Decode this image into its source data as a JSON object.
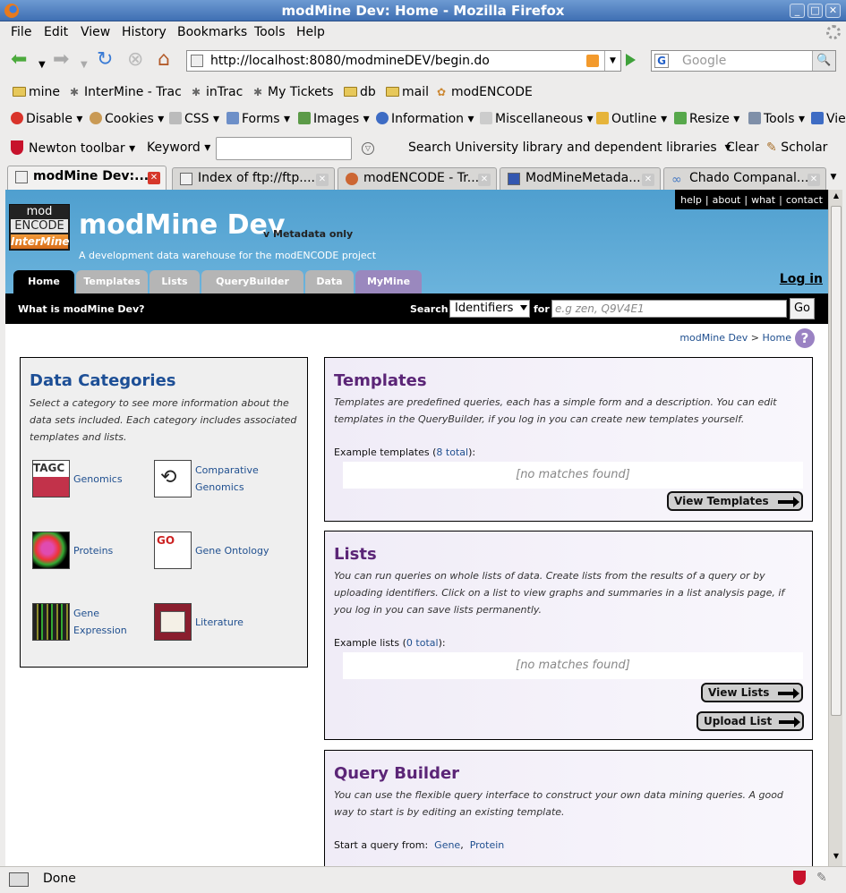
{
  "window": {
    "title": "modMine Dev: Home - Mozilla Firefox"
  },
  "menu": [
    "File",
    "Edit",
    "View",
    "History",
    "Bookmarks",
    "Tools",
    "Help"
  ],
  "nav": {
    "url": "http://localhost:8080/modmineDEV/begin.do",
    "search_placeholder": "Google"
  },
  "bookmarks": [
    "mine",
    "InterMine - Trac",
    "inTrac",
    "My Tickets",
    "db",
    "mail",
    "modENCODE"
  ],
  "webdev": [
    "Disable",
    "Cookies",
    "CSS",
    "Forms",
    "Images",
    "Information",
    "Miscellaneous",
    "Outline",
    "Resize",
    "Tools",
    "Vie"
  ],
  "newton": {
    "toolbar": "Newton toolbar",
    "keyword": "Keyword",
    "search_lib": "Search University library and dependent libraries",
    "clear": "Clear",
    "scholar": "Scholar"
  },
  "tabs": [
    "modMine Dev:...",
    "Index of ftp://ftp....",
    "modENCODE - Tr...",
    "ModMineMetada...",
    "Chado Companal..."
  ],
  "page": {
    "links": [
      "help",
      "about",
      "what",
      "contact"
    ],
    "logo": {
      "l1": "mod",
      "l2": "ENCODE",
      "l3": "InterMine"
    },
    "title": "modMine Dev",
    "version": "v Metadata only",
    "subtitle": "A development data warehouse for the modENCODE project",
    "login": "Log in",
    "menu_tabs": [
      "Home",
      "Templates",
      "Lists",
      "QueryBuilder",
      "Data",
      "MyMine"
    ],
    "what_link": "What is modMine Dev?",
    "search_label": "Search",
    "search_select": "Identifiers",
    "for_label": "for",
    "search_placeholder": "e.g zen, Q9V4E1",
    "go": "Go",
    "breadcrumb": {
      "root": "modMine Dev",
      "sep": ">",
      "current": "Home"
    },
    "help_icon": "?"
  },
  "data_categories": {
    "title": "Data Categories",
    "intro": "Select a category to see more information about the data sets included. Each category includes associated templates and lists.",
    "items": [
      {
        "label": "Genomics",
        "icon": "genomics-icon"
      },
      {
        "label": "Comparative Genomics",
        "icon": "comparative-genomics-icon"
      },
      {
        "label": "Proteins",
        "icon": "proteins-icon"
      },
      {
        "label": "Gene Ontology",
        "icon": "gene-ontology-icon"
      },
      {
        "label": "Gene Expression",
        "icon": "gene-expression-icon"
      },
      {
        "label": "Literature",
        "icon": "literature-icon"
      }
    ]
  },
  "templates": {
    "title": "Templates",
    "desc": "Templates are predefined queries, each has a simple form and a description. You can edit templates in the QueryBuilder, if you log in you can create new templates yourself.",
    "example_prefix": "Example templates (",
    "example_count": "8 total",
    "example_suffix": "):",
    "no_matches": "[no matches found]",
    "button": "View Templates"
  },
  "lists": {
    "title": "Lists",
    "desc": "You can run queries on whole lists of data. Create lists from the results of a query or by uploading identifiers. Click on a list to view graphs and summaries in a list analysis page, if you log in you can save lists permanently.",
    "example_prefix": "Example lists (",
    "example_count": "0 total",
    "example_suffix": "):",
    "no_matches": "[no matches found]",
    "view_button": "View Lists",
    "upload_button": "Upload List"
  },
  "querybuilder": {
    "title": "Query Builder",
    "desc": "You can use the flexible query interface to construct your own data mining queries. A good way to start is by editing an existing template.",
    "start_label": "Start a query from:",
    "starts": [
      "Gene",
      "Protein"
    ]
  },
  "status": {
    "text": "Done"
  }
}
